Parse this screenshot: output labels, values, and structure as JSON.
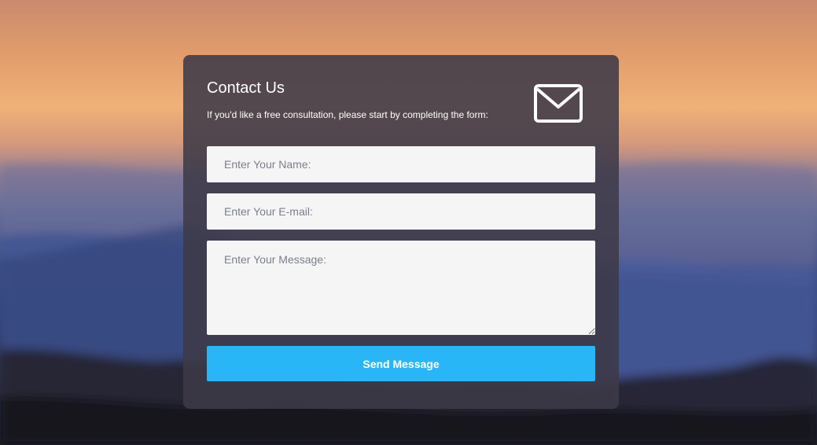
{
  "contact": {
    "title": "Contact Us",
    "subtitle": "If you'd like a free consultation, please start by completing the form:",
    "icon": "envelope-icon",
    "fields": {
      "name_placeholder": "Enter Your Name:",
      "email_placeholder": "Enter Your E-mail:",
      "message_placeholder": "Enter Your Message:",
      "name_value": "",
      "email_value": "",
      "message_value": ""
    },
    "submit_label": "Send Message"
  },
  "colors": {
    "card_background": "#3e3a48",
    "button": "#29b6f6",
    "field_background": "#f5f5f5",
    "text": "#ffffff"
  }
}
